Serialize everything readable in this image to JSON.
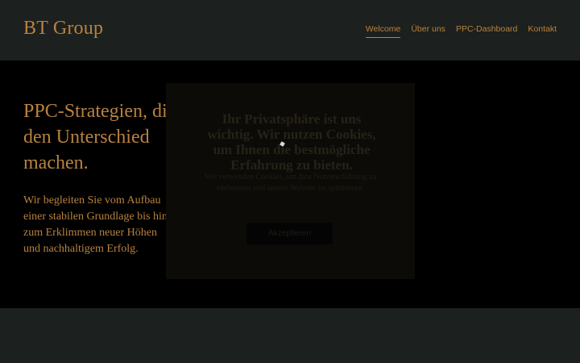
{
  "header": {
    "logo": "BT Group",
    "nav": [
      "Welcome",
      "Über uns",
      "PPC-Dashboard",
      "Kontakt"
    ],
    "active_nav": "Welcome"
  },
  "hero": {
    "title": "PPC-Strategien, die den Unterschied machen.",
    "text": "Wir begleiten Sie vom Aufbau einer stabilen Grundlage bis hin zum Erklimmen neuer Höhen und nachhaltigem Erfolg."
  },
  "modal": {
    "title": "Ihr Privatsphäre ist uns wichtig. Wir nutzen Cookies, um Ihnen die bestmögliche Erfahrung zu bieten.",
    "text": "Wir verwenden Cookies, um Ihre Nutzererfahrung zu verbessern und unsere Website zu optimieren.",
    "button": "Akzeptieren"
  },
  "colors": {
    "accent": "#b8823f",
    "header_bg": "#1c201e",
    "hero_bg": "#000000"
  }
}
